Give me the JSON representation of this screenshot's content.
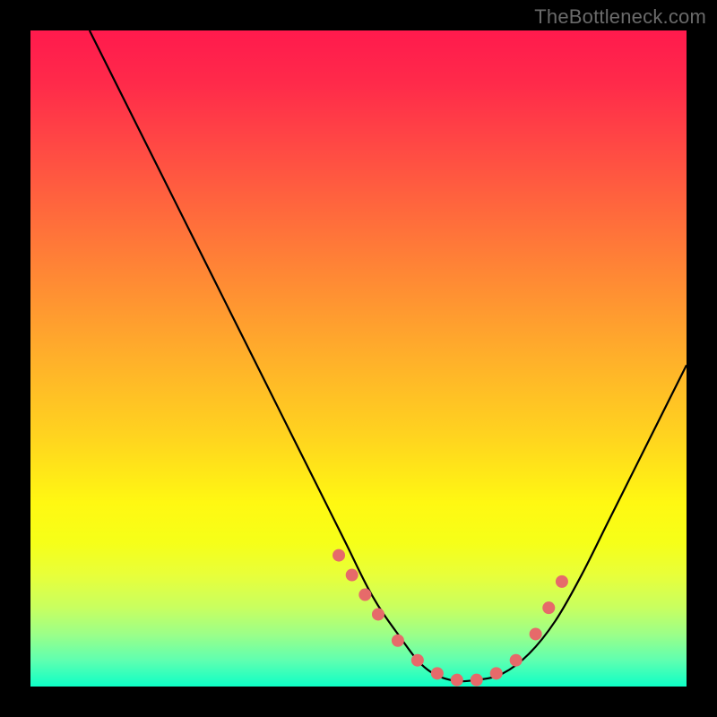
{
  "attribution": "TheBottleneck.com",
  "chart_data": {
    "type": "line",
    "title": "",
    "xlabel": "",
    "ylabel": "",
    "xlim": [
      0,
      100
    ],
    "ylim": [
      0,
      100
    ],
    "grid": false,
    "legend": false,
    "series": [
      {
        "name": "bottleneck-curve",
        "color": "#000000",
        "x": [
          9,
          12,
          16,
          20,
          24,
          28,
          32,
          36,
          40,
          44,
          48,
          52,
          56,
          60,
          64,
          68,
          72,
          76,
          80,
          84,
          88,
          92,
          96,
          100
        ],
        "values": [
          100,
          94,
          86,
          78,
          70,
          62,
          54,
          46,
          38,
          30,
          22,
          14,
          8,
          3,
          1,
          1,
          2,
          5,
          10,
          17,
          25,
          33,
          41,
          49
        ]
      }
    ],
    "markers": {
      "name": "highlight-dots",
      "color": "#e66a6a",
      "radius": 7,
      "x": [
        47,
        49,
        51,
        53,
        56,
        59,
        62,
        65,
        68,
        71,
        74,
        77,
        79,
        81
      ],
      "values": [
        20,
        17,
        14,
        11,
        7,
        4,
        2,
        1,
        1,
        2,
        4,
        8,
        12,
        16
      ]
    },
    "background_gradient": {
      "type": "vertical",
      "stops": [
        {
          "pos": 0.0,
          "color": "#ff1a4d"
        },
        {
          "pos": 0.5,
          "color": "#ffb02a"
        },
        {
          "pos": 0.75,
          "color": "#fff812"
        },
        {
          "pos": 1.0,
          "color": "#0effc6"
        }
      ]
    }
  }
}
